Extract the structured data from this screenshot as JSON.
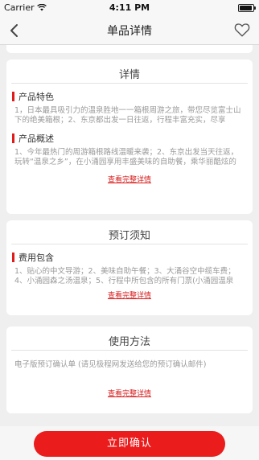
{
  "status_bar": {
    "carrier": "Carrier",
    "time": "4:11 PM",
    "battery_level": 0.95
  },
  "nav": {
    "title": "单品详情"
  },
  "details": {
    "title": "详情",
    "feature_head": "产品特色",
    "feature_text": "1，日本最具吸引力的温泉胜地一一箱根周游之旅，带您尽览富士山下的绝美箱根；2、东京都出发一日往返，行程丰富充实，尽享",
    "overview_head": "产品概述",
    "overview_text": "1、今年最热门的周游箱根路线温暖来袭；2、东京出发当天往返，玩转“温泉之乡”，在小涌园享用丰盛美味的自助餐，乘华丽酷炫的",
    "more_link": "查看完整详情"
  },
  "booking": {
    "title": "预订须知",
    "fee_head": "费用包含",
    "fee_text": "1、贴心的中文导游；2、美味自助午餐；3、大涌谷空中缆车费；4、小涌园森之汤温泉；5、行程中所包含的所有门票(小涌园温泉",
    "more_link": "查看完整详情"
  },
  "usage": {
    "title": "使用方法",
    "text": "电子版预订确认单 (请见极程网发送给您的预订确认邮件)",
    "more_link": "查看完整详情"
  },
  "confirm_button": "立即确认",
  "colors": {
    "accent": "#ea1c1c",
    "background": "#efefef"
  },
  "icons": {
    "back": "chevron-left-icon",
    "favorite": "heart-outline-icon",
    "wifi": "wifi-icon"
  }
}
